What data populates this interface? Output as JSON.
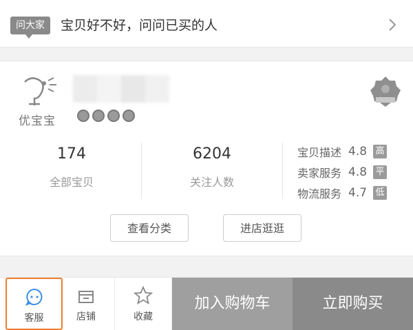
{
  "ask": {
    "badge": "问大家",
    "text": "宝贝好不好，问问已买的人"
  },
  "shop": {
    "logo_text": "优宝宝",
    "stats": [
      {
        "value": "174",
        "label": "全部宝贝"
      },
      {
        "value": "6204",
        "label": "关注人数"
      }
    ],
    "scores": [
      {
        "label": "宝贝描述",
        "value": "4.8",
        "level": "高"
      },
      {
        "label": "卖家服务",
        "value": "4.8",
        "level": "平"
      },
      {
        "label": "物流服务",
        "value": "4.7",
        "level": "低"
      }
    ],
    "buttons": {
      "category": "查看分类",
      "enter": "进店逛逛"
    }
  },
  "bottom": {
    "service": "客服",
    "store": "店铺",
    "favorite": "收藏",
    "add_to_cart": "加入购物车",
    "buy_now": "立即购买"
  },
  "colors": {
    "highlight": "#f07d2e",
    "cart_bg": "#9f9f9f",
    "buy_bg": "#8a8a8a"
  }
}
